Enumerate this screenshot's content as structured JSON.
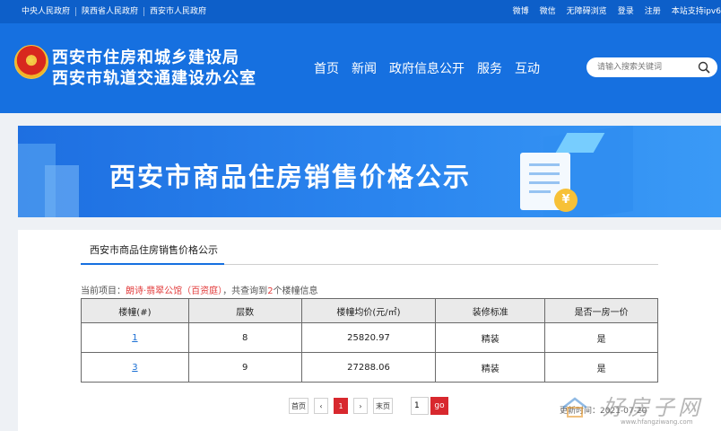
{
  "topbar": {
    "left_links": [
      "中央人民政府",
      "陕西省人民政府",
      "西安市人民政府"
    ],
    "right_links": [
      "微博",
      "微信",
      "无障碍浏览",
      "登录",
      "注册",
      "本站支持ipv6"
    ]
  },
  "header": {
    "org_line1": "西安市住房和城乡建设局",
    "org_line2": "西安市轨道交通建设办公室",
    "nav": [
      "首页",
      "新闻",
      "政府信息公开",
      "服务",
      "互动"
    ],
    "search_placeholder": "请输入搜索关键词"
  },
  "banner": {
    "title": "西安市商品住房销售价格公示",
    "coin_symbol": "¥"
  },
  "content": {
    "tab_label": "西安市商品住房销售价格公示",
    "info_prefix": "当前项目：",
    "project_name": "朗诗·翡翠公馆（百资庭）",
    "info_middle": "，共查询到",
    "count": "2",
    "info_suffix": "个楼幢信息",
    "table": {
      "headers": [
        "楼幢(#)",
        "层数",
        "楼幢均价(元/㎡)",
        "装修标准",
        "是否一房一价"
      ],
      "rows": [
        [
          "1",
          "8",
          "25820.97",
          "精装",
          "是"
        ],
        [
          "3",
          "9",
          "27288.06",
          "精装",
          "是"
        ]
      ]
    },
    "pager": {
      "first": "首页",
      "prev": "‹",
      "current": "1",
      "next": "›",
      "last": "末页",
      "page_input": "1",
      "go": "go"
    },
    "update_text": "更新时间：2021-07-20"
  },
  "watermark": {
    "brand": "好房子网",
    "url": "www.hfangziwang.com"
  },
  "colors": {
    "primary_blue": "#1670e0",
    "topbar_blue": "#0d5fc9",
    "accent_red": "#d8282e",
    "link_blue": "#1a6fd4"
  }
}
